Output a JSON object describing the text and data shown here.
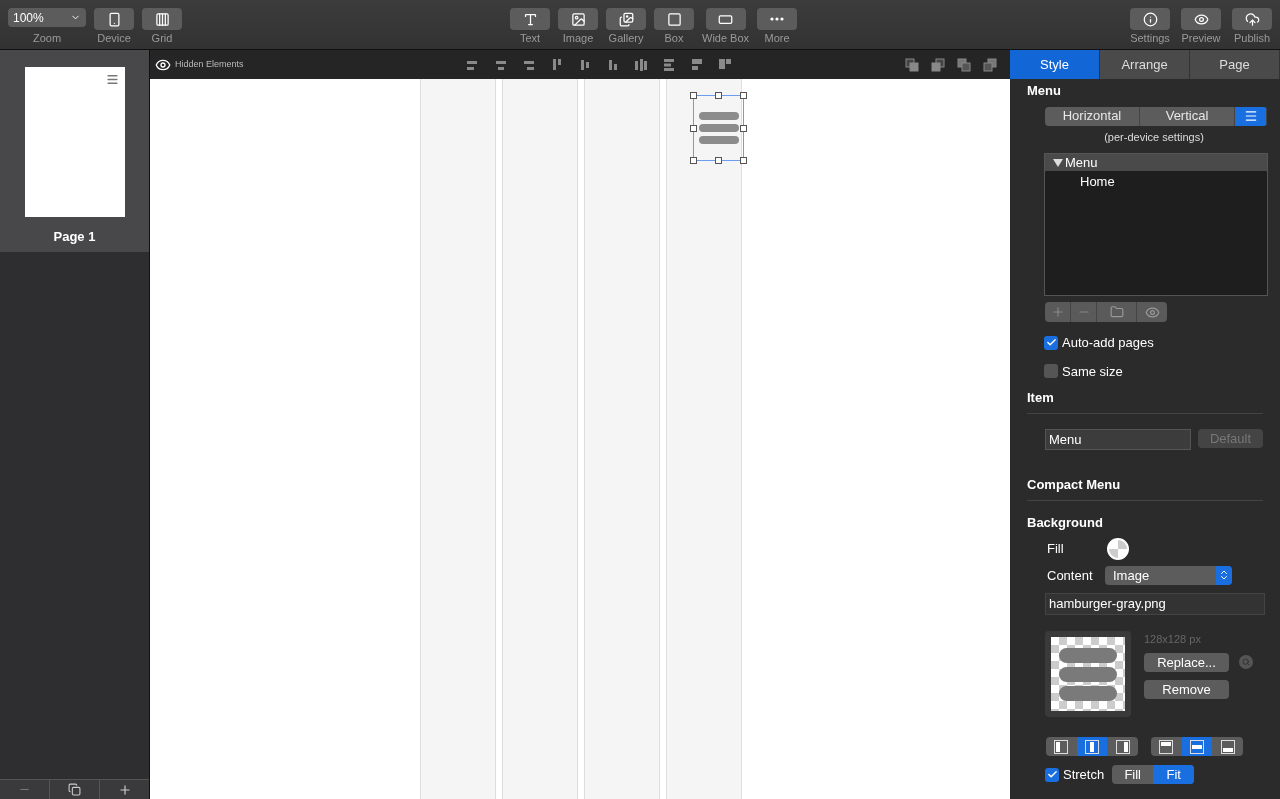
{
  "toolbar": {
    "zoom": {
      "value": "100%",
      "label": "Zoom"
    },
    "left_buttons": [
      {
        "kind": "device",
        "label": "Device"
      },
      {
        "kind": "grid",
        "label": "Grid"
      }
    ],
    "center_buttons": [
      {
        "kind": "text",
        "label": "Text"
      },
      {
        "kind": "image",
        "label": "Image"
      },
      {
        "kind": "gallery",
        "label": "Gallery"
      },
      {
        "kind": "box",
        "label": "Box"
      },
      {
        "kind": "widebox",
        "label": "Wide Box"
      },
      {
        "kind": "more",
        "label": "More"
      }
    ],
    "right_buttons": [
      {
        "kind": "settings",
        "label": "Settings"
      },
      {
        "kind": "preview",
        "label": "Preview"
      },
      {
        "kind": "publish",
        "label": "Publish"
      }
    ]
  },
  "pages": [
    {
      "label": "Page 1",
      "selected": true
    }
  ],
  "canvas_bar": {
    "hidden_elements": "Hidden Elements"
  },
  "canvas": {
    "menu_selected": true
  },
  "inspector": {
    "tabs": [
      {
        "label": "Style",
        "selected": true
      },
      {
        "label": "Arrange",
        "selected": false
      },
      {
        "label": "Page",
        "selected": false
      }
    ],
    "menu": {
      "title": "Menu",
      "layouts": [
        {
          "kind": "text",
          "label": "Horizontal",
          "selected": false
        },
        {
          "kind": "text",
          "label": "Vertical",
          "selected": false
        },
        {
          "kind": "icon",
          "selected": true
        }
      ],
      "note": "(per-device settings)",
      "tree": [
        {
          "label": "Menu",
          "expanded": true,
          "children": [
            {
              "label": "Home"
            }
          ]
        }
      ],
      "checkboxes": [
        {
          "label": "Auto-add pages",
          "checked": true
        },
        {
          "label": "Same size",
          "checked": false
        }
      ]
    },
    "item": {
      "title": "Item",
      "name_value": "Menu",
      "default_button": "Default",
      "default_disabled": true
    },
    "compact_menu": {
      "title": "Compact Menu"
    },
    "background": {
      "title": "Background",
      "fill_label": "Fill",
      "content_label": "Content",
      "content_value": "Image",
      "filename": "hamburger-gray.png",
      "image_size": "128x128 px",
      "replace_button": "Replace...",
      "remove_button": "Remove",
      "h_align": [
        {
          "selected": false
        },
        {
          "selected": true
        },
        {
          "selected": false
        }
      ],
      "v_align": [
        {
          "selected": false
        },
        {
          "selected": true
        },
        {
          "selected": false
        }
      ],
      "stretch": {
        "label": "Stretch",
        "checked": true
      },
      "fit_options": [
        {
          "label": "Fill",
          "selected": false
        },
        {
          "label": "Fit",
          "selected": true
        }
      ]
    }
  }
}
